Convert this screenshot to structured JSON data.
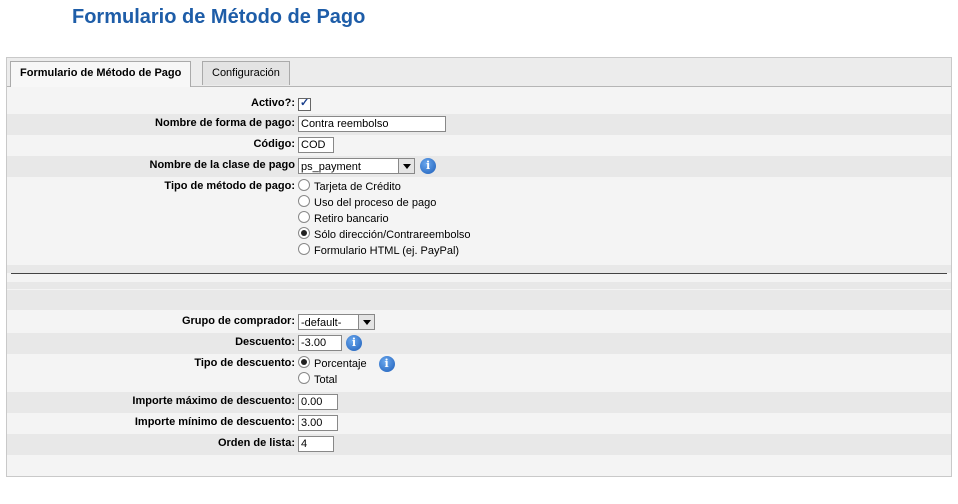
{
  "page": {
    "title": "Formulario de Método de Pago"
  },
  "tabs": [
    {
      "label": "Formulario de Método de Pago",
      "active": true
    },
    {
      "label": "Configuración",
      "active": false
    }
  ],
  "form": {
    "active": {
      "label": "Activo?:",
      "checked": true
    },
    "name": {
      "label": "Nombre de forma de pago:",
      "value": "Contra reembolso"
    },
    "code": {
      "label": "Código:",
      "value": "COD"
    },
    "class": {
      "label": "Nombre de la clase de pago",
      "value": "ps_payment"
    },
    "type": {
      "label": "Tipo de método de pago:",
      "options": [
        {
          "label": "Tarjeta de Crédito",
          "selected": false
        },
        {
          "label": "Uso del proceso de pago",
          "selected": false
        },
        {
          "label": "Retiro bancario",
          "selected": false
        },
        {
          "label": "Sólo dirección/Contrareembolso",
          "selected": true
        },
        {
          "label": "Formulario HTML (ej. PayPal)",
          "selected": false
        }
      ]
    },
    "group": {
      "label": "Grupo de comprador:",
      "value": "-default-"
    },
    "discount": {
      "label": "Descuento:",
      "value": "-3.00"
    },
    "discount_type": {
      "label": "Tipo de descuento:",
      "options": [
        {
          "label": "Porcentaje",
          "selected": true
        },
        {
          "label": "Total",
          "selected": false
        }
      ]
    },
    "max_discount": {
      "label": "Importe máximo de descuento:",
      "value": "0.00"
    },
    "min_discount": {
      "label": "Importe mínimo de descuento:",
      "value": "3.00"
    },
    "order": {
      "label": "Orden de lista:",
      "value": "4"
    }
  },
  "icons": {
    "info": "info-icon",
    "checkbox": "checkmark-icon",
    "dropdown": "chevron-down-icon"
  },
  "colors": {
    "title": "#1e5da8",
    "row_shade": "#e8e8e8",
    "info_icon": "#1d5db8"
  }
}
